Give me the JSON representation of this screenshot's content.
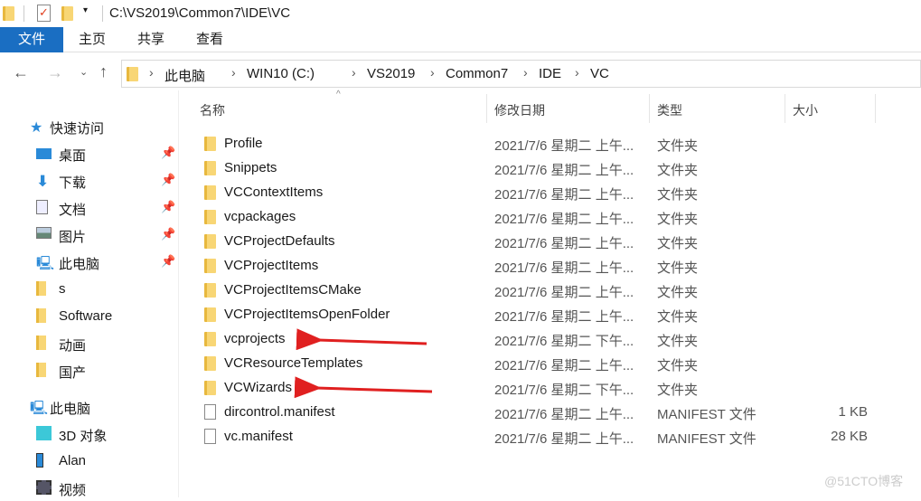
{
  "window": {
    "title": "C:\\VS2019\\Common7\\IDE\\VC"
  },
  "ribbon": {
    "tabs": [
      "文件",
      "主页",
      "共享",
      "查看"
    ],
    "active_color": "#1a6ec2"
  },
  "breadcrumb": [
    "此电脑",
    "WIN10 (C:)",
    "VS2019",
    "Common7",
    "IDE",
    "VC"
  ],
  "sidebar": {
    "items": [
      {
        "label": "快速访问",
        "icon": "star-icon",
        "level": 0
      },
      {
        "label": "桌面",
        "icon": "desktop-icon",
        "level": 1,
        "pinned": true
      },
      {
        "label": "下载",
        "icon": "download-icon",
        "level": 1,
        "pinned": true
      },
      {
        "label": "文档",
        "icon": "document-icon",
        "level": 1,
        "pinned": true
      },
      {
        "label": "图片",
        "icon": "pictures-icon",
        "level": 1,
        "pinned": true
      },
      {
        "label": "此电脑",
        "icon": "computer-icon",
        "level": 1,
        "pinned": true
      },
      {
        "label": "s",
        "icon": "folder-icon",
        "level": 1
      },
      {
        "label": "Software",
        "icon": "folder-icon",
        "level": 1
      },
      {
        "label": "动画",
        "icon": "folder-icon",
        "level": 1
      },
      {
        "label": "国产",
        "icon": "folder-icon",
        "level": 1
      },
      {
        "label": "此电脑",
        "icon": "computer-icon",
        "level": 0
      },
      {
        "label": "3D 对象",
        "icon": "3d-objects-icon",
        "level": 1
      },
      {
        "label": "Alan",
        "icon": "phone-icon",
        "level": 1
      },
      {
        "label": "视频",
        "icon": "video-icon",
        "level": 1
      }
    ]
  },
  "columns": {
    "name": "名称",
    "date": "修改日期",
    "type": "类型",
    "size": "大小"
  },
  "files": [
    {
      "name": "Profile",
      "date": "2021/7/6 星期二 上午...",
      "type": "文件夹",
      "size": "",
      "kind": "folder"
    },
    {
      "name": "Snippets",
      "date": "2021/7/6 星期二 上午...",
      "type": "文件夹",
      "size": "",
      "kind": "folder"
    },
    {
      "name": "VCContextItems",
      "date": "2021/7/6 星期二 上午...",
      "type": "文件夹",
      "size": "",
      "kind": "folder"
    },
    {
      "name": "vcpackages",
      "date": "2021/7/6 星期二 上午...",
      "type": "文件夹",
      "size": "",
      "kind": "folder"
    },
    {
      "name": "VCProjectDefaults",
      "date": "2021/7/6 星期二 上午...",
      "type": "文件夹",
      "size": "",
      "kind": "folder"
    },
    {
      "name": "VCProjectItems",
      "date": "2021/7/6 星期二 上午...",
      "type": "文件夹",
      "size": "",
      "kind": "folder"
    },
    {
      "name": "VCProjectItemsCMake",
      "date": "2021/7/6 星期二 上午...",
      "type": "文件夹",
      "size": "",
      "kind": "folder"
    },
    {
      "name": "VCProjectItemsOpenFolder",
      "date": "2021/7/6 星期二 上午...",
      "type": "文件夹",
      "size": "",
      "kind": "folder"
    },
    {
      "name": "vcprojects",
      "date": "2021/7/6 星期二 下午...",
      "type": "文件夹",
      "size": "",
      "kind": "folder"
    },
    {
      "name": "VCResourceTemplates",
      "date": "2021/7/6 星期二 上午...",
      "type": "文件夹",
      "size": "",
      "kind": "folder"
    },
    {
      "name": "VCWizards",
      "date": "2021/7/6 星期二 下午...",
      "type": "文件夹",
      "size": "",
      "kind": "folder"
    },
    {
      "name": "dircontrol.manifest",
      "date": "2021/7/6 星期二 上午...",
      "type": "MANIFEST 文件",
      "size": "1 KB",
      "kind": "file"
    },
    {
      "name": "vc.manifest",
      "date": "2021/7/6 星期二 上午...",
      "type": "MANIFEST 文件",
      "size": "28 KB",
      "kind": "file"
    }
  ],
  "annotation_color": "#e02020",
  "watermark": "@51CTO博客"
}
